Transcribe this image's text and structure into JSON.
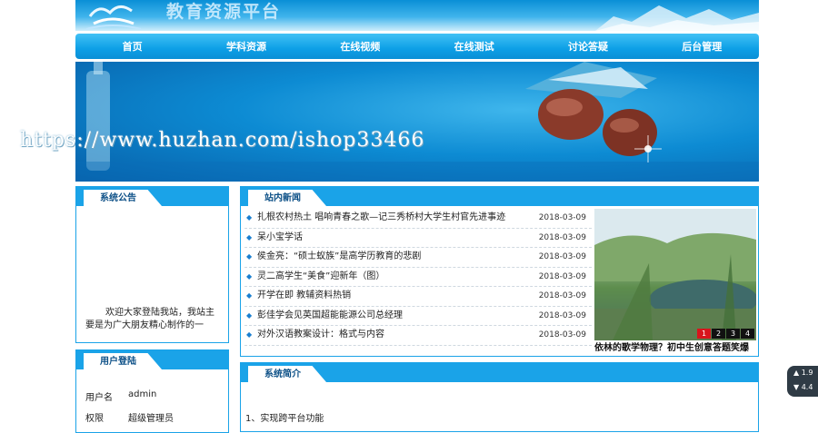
{
  "header": {
    "title": "教育资源平台"
  },
  "nav": {
    "items": [
      "首页",
      "学科资源",
      "在线视频",
      "在线测试",
      "讨论答疑",
      "后台管理"
    ]
  },
  "watermark": "https://www.huzhan.com/ishop33466",
  "notice": {
    "title": "系统公告",
    "text": "欢迎大家登陆我站，我站主要是为广大朋友精心制作的一"
  },
  "login": {
    "title": "用户登陆",
    "username_label": "用户名",
    "username_value": "admin",
    "role_label": "权限",
    "role_value": "超级管理员"
  },
  "news": {
    "title": "站内新闻",
    "items": [
      {
        "title": "扎根农村热土 唱响青春之歌—记三秀桥村大学生村官先进事迹",
        "date": "2018-03-09"
      },
      {
        "title": "呆小宝学话",
        "date": "2018-03-09"
      },
      {
        "title": "侯金亮：“硕士蚁族”是高学历教育的悲剧",
        "date": "2018-03-09"
      },
      {
        "title": "灵二高学生“美食”迎新年（图）",
        "date": "2018-03-09"
      },
      {
        "title": "开学在即 教辅资料热销",
        "date": "2018-03-09"
      },
      {
        "title": "彭佳学会见英国超能能源公司总经理",
        "date": "2018-03-09"
      },
      {
        "title": "对外汉语教案设计：格式与内容",
        "date": "2018-03-09"
      }
    ],
    "pager": [
      "1",
      "2",
      "3",
      "4"
    ],
    "caption": "依林的歌学物理？初中生创意答题笑爆"
  },
  "intro": {
    "title": "系统简介",
    "line1": "1、实现跨平台功能"
  },
  "widget": {
    "line1": "▲ 1.9",
    "line2": "▼ 4.4"
  }
}
